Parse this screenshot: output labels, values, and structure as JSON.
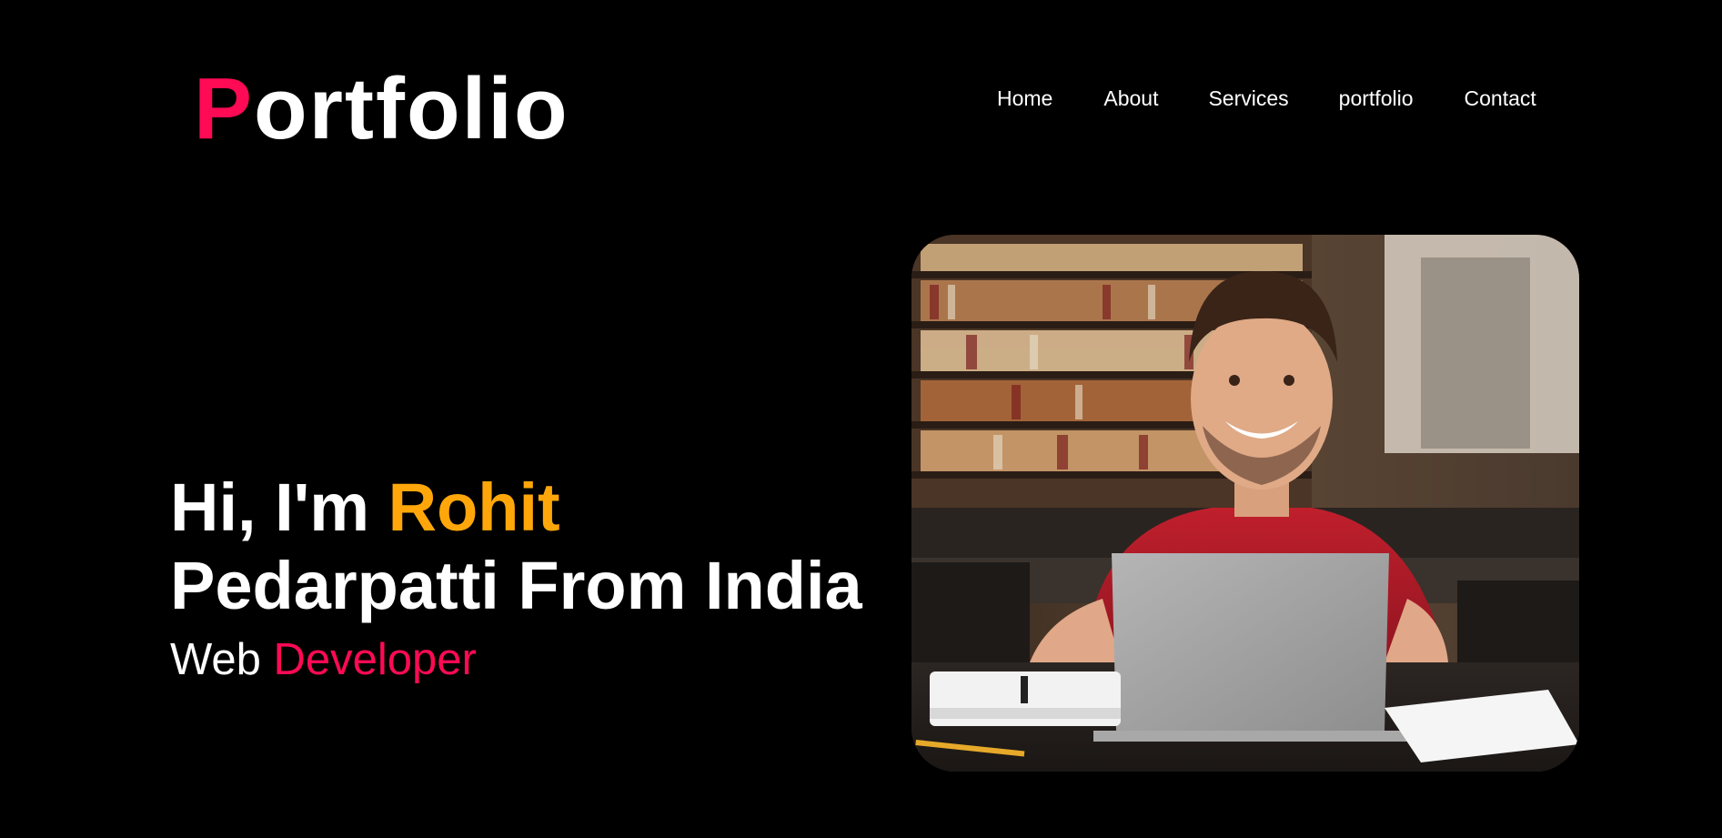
{
  "header": {
    "logo_accent": "P",
    "logo_rest": "ortfolio",
    "nav": {
      "home": "Home",
      "about": "About",
      "services": "Services",
      "portfolio": "portfolio",
      "contact": "Contact"
    }
  },
  "hero": {
    "greeting": "Hi, I'm ",
    "first_name": "Rohit",
    "line2": "Pedarpatti From India",
    "role_prefix": "Web ",
    "role_accent": "Developer"
  },
  "colors": {
    "background": "#000000",
    "accent_pink": "#ff0a54",
    "accent_orange": "#ffa70a",
    "text": "#ffffff"
  },
  "icons": {
    "profile_photo": "student-with-laptop-photo"
  }
}
